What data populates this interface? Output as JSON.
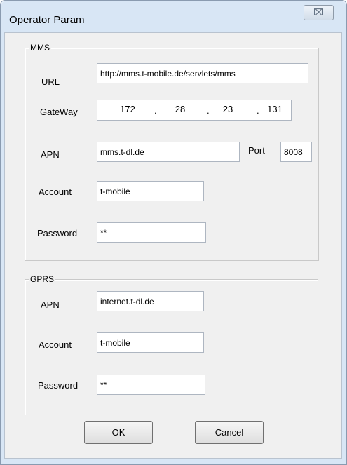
{
  "window": {
    "title": "Operator Param",
    "close_label": "⌧"
  },
  "mms": {
    "legend": "MMS",
    "url_label": "URL",
    "url_value": "http://mms.t-mobile.de/servlets/mms",
    "gateway_label": "GateWay",
    "gateway_octets": [
      "172",
      "28",
      "23",
      "131"
    ],
    "gateway_separator": ".",
    "apn_label": "APN",
    "apn_value": "mms.t-dl.de",
    "port_label": "Port",
    "port_value": "8008",
    "account_label": "Account",
    "account_value": "t-mobile",
    "password_label": "Password",
    "password_value": "**"
  },
  "gprs": {
    "legend": "GPRS",
    "apn_label": "APN",
    "apn_value": "internet.t-dl.de",
    "account_label": "Account",
    "account_value": "t-mobile",
    "password_label": "Password",
    "password_value": "**"
  },
  "buttons": {
    "ok_label": "OK",
    "cancel_label": "Cancel"
  }
}
